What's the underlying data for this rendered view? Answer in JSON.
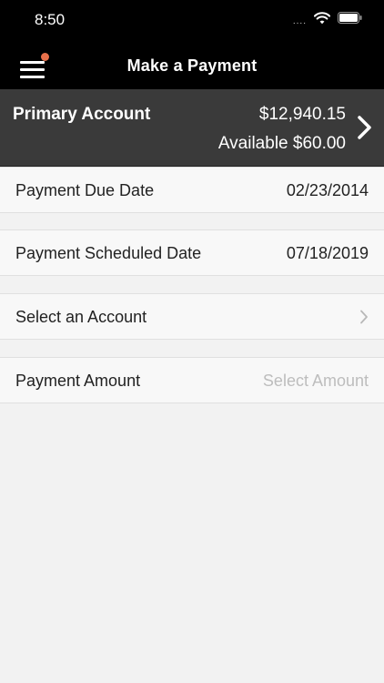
{
  "status_bar": {
    "time": "8:50",
    "signal": "....",
    "icons": [
      "wifi-icon",
      "battery-icon"
    ]
  },
  "nav": {
    "title": "Make a Payment",
    "menu_icon": "hamburger-menu-icon",
    "notification_color": "#e8704a"
  },
  "account": {
    "name": "Primary Account",
    "balance": "$12,940.15",
    "available": "Available $60.00"
  },
  "rows": {
    "due_date": {
      "label": "Payment Due Date",
      "value": "02/23/2014"
    },
    "scheduled_date": {
      "label": "Payment Scheduled Date",
      "value": "07/18/2019"
    },
    "select_account": {
      "label": "Select an Account"
    },
    "amount": {
      "label": "Payment Amount",
      "placeholder": "Select Amount"
    }
  },
  "colors": {
    "header_bg": "#000000",
    "account_bg": "#3a3a3a",
    "page_bg": "#f2f2f2",
    "accent": "#e8704a"
  }
}
